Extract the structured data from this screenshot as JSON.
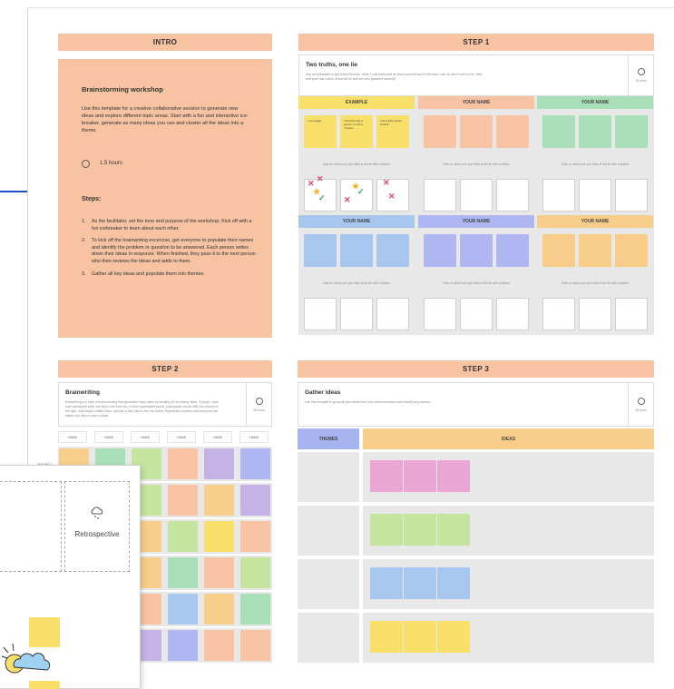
{
  "intro": {
    "header": "INTRO",
    "title": "Brainstorming workshop",
    "body": "Use this template for a creative collaborative session to generate new ideas and explore different topic areas. Start with a fun and interactive ice-breaker, generate as many ideas you can and cluster all the ideas into a theme.",
    "duration": "1.5 hours",
    "steps_heading": "Steps:",
    "steps": [
      "As the facilitator, set the tone and purpose of the workshop. Kick off with a fun icebreaker to learn about each other.",
      "To kick off the brainwriting excercise, get everyone to populate their names and identify the problem or question to be answered. Each person writes down their ideas in response. When finished, they pass it to the next person who then reviews the ideas and adds to them.",
      "Gather all key ideas and populate them into themes."
    ]
  },
  "step1": {
    "header": "STEP 1",
    "title": "Two truths, one lie",
    "desc": "Use an icebreaker to get know the team. Write 2 real truths and lie about yourself and let the team vote on which one is a lie. After everyone has voted, reveal the lie and see who guessed correctly!",
    "time": "15 mins",
    "example_label": "EXAMPLE",
    "your_name": "YOUR NAME",
    "vote_text": "Vote on which one you think is the lie with a sticker",
    "example_notes": [
      "I can juggle",
      "I lived through a period in such a Yonkers",
      "I ate a blue-whole chicken"
    ]
  },
  "step2": {
    "header": "STEP 2",
    "title": "Brainwriting",
    "desc": "Brainwriting is a style of brainstorming that generates many ideas by building off of existing ideas. To begin, have each participant write one idea in the first row. In each subsequent round, participants should shift one column to the right, read what's written there, and add a new idea in the row below. Repeat this process until everyone has added one idea to each column.",
    "time": "45 mins",
    "name_label": "NAME",
    "round_label": "ROUND 1"
  },
  "step3": {
    "header": "STEP 3",
    "title": "Gather ideas",
    "desc": "Use this template to group all your ideas from your initial brainstorm and identify key themes.",
    "time": "45 mins",
    "themes_label": "THEMES",
    "ideas_label": "IDEAS"
  },
  "overlay": {
    "tile_label": "Retrospective"
  },
  "colors": {
    "peach": "#f7c3a3",
    "yellow": "#f9e06a",
    "green": "#a8dfb9",
    "blue": "#a7c7ef",
    "purple": "#b0b6f2",
    "orange": "#f9cd8a",
    "pink": "#eaa7d6",
    "lime": "#c5e4a0",
    "lavender": "#c6b3e6",
    "accent": "#1f4fc7"
  }
}
